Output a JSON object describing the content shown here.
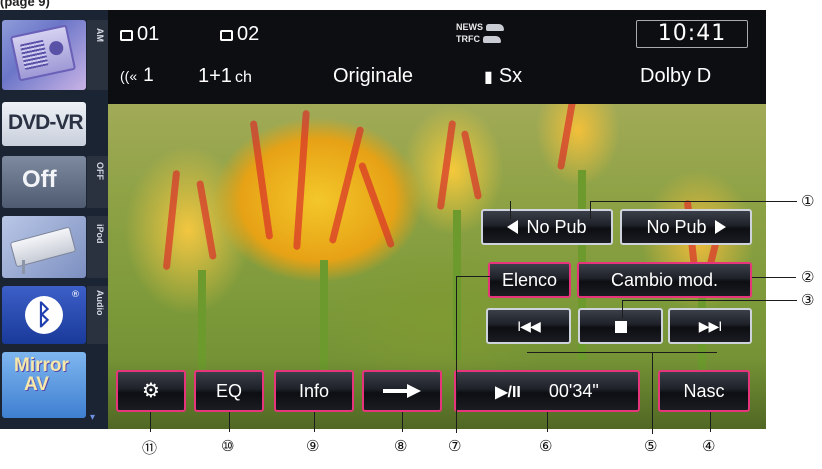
{
  "page_header": "(page 9)",
  "source_bar": {
    "tabs": [
      "AM",
      "OFF",
      "iPod",
      "Audio"
    ],
    "buttons": {
      "radio_icon": "radio-icon",
      "dvd_label": "DVD-VR",
      "off_label": "Off",
      "ipod_icon": "ipod-icon",
      "bluetooth_icon": "bluetooth-icon",
      "bluetooth_reg": "®",
      "mirror_label_1": "Mirror",
      "mirror_label_2": "AV"
    },
    "scroll_icon": "▾"
  },
  "status": {
    "subtitle_value": "01",
    "title_value": "02",
    "angle_value": "1",
    "audio_channels": "1+1",
    "audio_ch_unit": "ch",
    "audio_mode": "Originale",
    "speaker_value": "Sx",
    "audio_format": "Dolby D",
    "news_label": "NEWS",
    "trfc_label": "TRFC",
    "clock": "10:41"
  },
  "controls": {
    "prev_pub_label": "No Pub",
    "next_pub_label": "No Pub",
    "list_label": "Elenco",
    "mode_label": "Cambio mod.",
    "prev_track_glyph": "I◀◀",
    "stop_glyph": "■",
    "next_track_glyph": "▶▶I",
    "settings_glyph": "⚙",
    "eq_label": "EQ",
    "info_label": "Info",
    "play_pause_label": "▶/II",
    "elapsed_time": "00'34\"",
    "hide_label": "Nasc"
  },
  "callouts": [
    "①",
    "②",
    "③",
    "④",
    "⑤",
    "⑥",
    "⑦",
    "⑧",
    "⑨",
    "⑩",
    "⑪"
  ],
  "colors": {
    "button_highlight": "#e6357a",
    "status_bar_bg": "#0c0e12",
    "source_bar_bg": "#1b2432"
  }
}
